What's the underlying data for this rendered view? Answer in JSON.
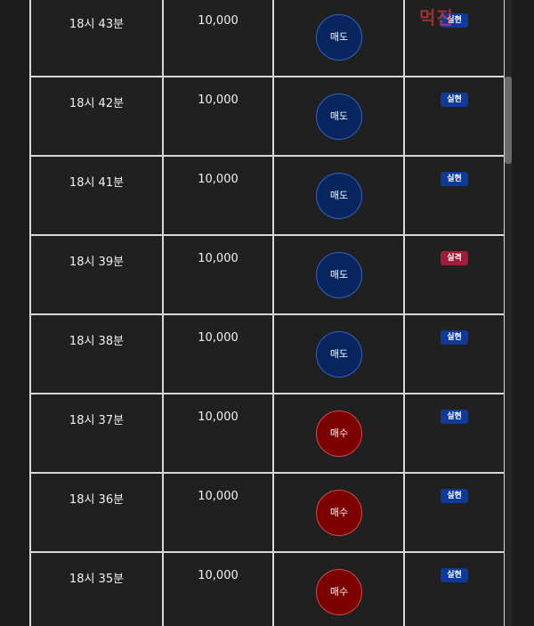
{
  "rows": [
    {
      "time": "18시 43분",
      "amount": "10,000",
      "action": "매도",
      "action_type": "sell",
      "result": "실현",
      "result_type": "success"
    },
    {
      "time": "18시 42분",
      "amount": "10,000",
      "action": "매도",
      "action_type": "sell",
      "result": "실현",
      "result_type": "success"
    },
    {
      "time": "18시 41분",
      "amount": "10,000",
      "action": "매도",
      "action_type": "sell",
      "result": "실현",
      "result_type": "success"
    },
    {
      "time": "18시 39분",
      "amount": "10,000",
      "action": "매도",
      "action_type": "sell",
      "result": "실격",
      "result_type": "fail"
    },
    {
      "time": "18시 38분",
      "amount": "10,000",
      "action": "매도",
      "action_type": "sell",
      "result": "실현",
      "result_type": "success"
    },
    {
      "time": "18시 37분",
      "amount": "10,000",
      "action": "매수",
      "action_type": "buy",
      "result": "실현",
      "result_type": "success"
    },
    {
      "time": "18시 36분",
      "amount": "10,000",
      "action": "매수",
      "action_type": "buy",
      "result": "실현",
      "result_type": "success"
    },
    {
      "time": "18시 35분",
      "amount": "10,000",
      "action": "매수",
      "action_type": "buy",
      "result": "실현",
      "result_type": "success"
    }
  ],
  "colors": {
    "background": "#1c1c1c",
    "row_background": "#202020",
    "grid_line": "#d8d8d8",
    "sell_circle": "#08255f",
    "buy_circle": "#7d0000",
    "success_badge": "#0e3a9a",
    "fail_badge": "#a11b3a"
  },
  "watermark": {
    "logo_text": "먹진",
    "subtitle": ""
  }
}
